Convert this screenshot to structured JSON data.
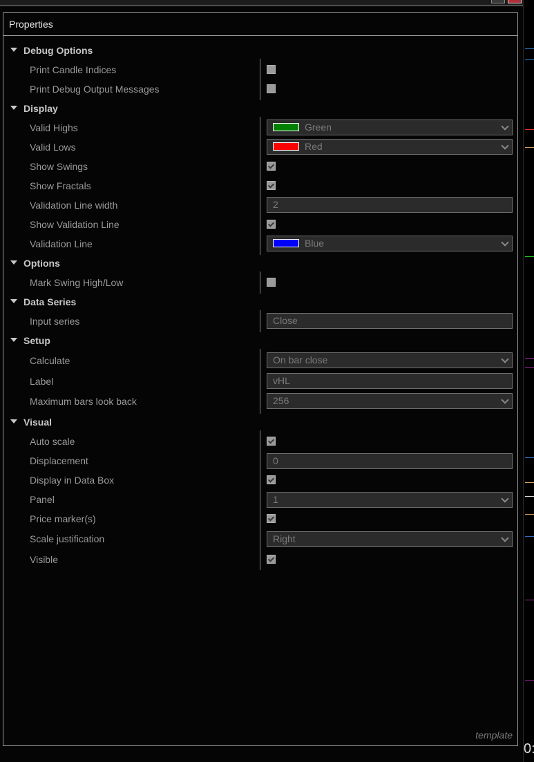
{
  "panel": {
    "title": "Properties",
    "footer": "template"
  },
  "strip_text": "0:",
  "colors": {
    "green": "#008000",
    "red": "#ff0000",
    "blue": "#0000ff"
  },
  "categories": {
    "debug": "Debug Options",
    "display": "Display",
    "options": "Options",
    "data_series": "Data Series",
    "setup": "Setup",
    "visual": "Visual"
  },
  "props": {
    "print_candle_indices": {
      "label": "Print Candle Indices",
      "checked": false
    },
    "print_debug_output": {
      "label": "Print Debug Output Messages",
      "checked": false
    },
    "valid_highs": {
      "label": "Valid Highs",
      "value": "Green"
    },
    "valid_lows": {
      "label": "Valid Lows",
      "value": "Red"
    },
    "show_swings": {
      "label": "Show Swings",
      "checked": true
    },
    "show_fractals": {
      "label": "Show Fractals",
      "checked": true
    },
    "validation_line_width": {
      "label": "Validation Line width",
      "value": "2"
    },
    "show_validation_line": {
      "label": "Show Validation Line",
      "checked": true
    },
    "validation_line": {
      "label": "Validation Line",
      "value": "Blue"
    },
    "mark_swing": {
      "label": "Mark Swing High/Low",
      "checked": false
    },
    "input_series": {
      "label": "Input series",
      "value": "Close"
    },
    "calculate": {
      "label": "Calculate",
      "value": "On bar close"
    },
    "label": {
      "label": "Label",
      "value": "vHL"
    },
    "max_bars": {
      "label": "Maximum bars look back",
      "value": "256"
    },
    "auto_scale": {
      "label": "Auto scale",
      "checked": true
    },
    "displacement": {
      "label": "Displacement",
      "value": "0"
    },
    "display_in_data_box": {
      "label": "Display in Data Box",
      "checked": true
    },
    "panel": {
      "label": "Panel",
      "value": "1"
    },
    "price_markers": {
      "label": "Price marker(s)",
      "checked": true
    },
    "scale_justification": {
      "label": "Scale justification",
      "value": "Right"
    },
    "visible": {
      "label": "Visible",
      "checked": true
    }
  }
}
